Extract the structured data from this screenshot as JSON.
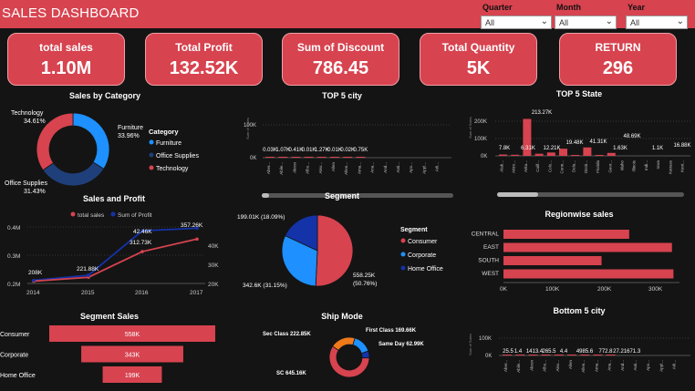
{
  "header": {
    "title": "SALES DASHBOARD"
  },
  "filters": [
    {
      "label": "Quarter",
      "value": "All"
    },
    {
      "label": "Month",
      "value": "All"
    },
    {
      "label": "Year",
      "value": "All"
    }
  ],
  "kpis": [
    {
      "label": "total sales",
      "value": "1.10M"
    },
    {
      "label": "Total Profit",
      "value": "132.52K"
    },
    {
      "label": "Sum of Discount",
      "value": "786.45"
    },
    {
      "label": "Total Quantity",
      "value": "5K"
    },
    {
      "label": "RETURN",
      "value": "296"
    }
  ],
  "colors": {
    "accent": "#d7434f",
    "blue": "#1e90ff",
    "navy": "#1f3f7a",
    "dark_blue": "#1433a8",
    "orange": "#f07a1a",
    "bg": "#141414"
  },
  "charts": {
    "category": {
      "title": "Sales by Category",
      "legend_title": "Category",
      "labels": [
        {
          "name": "Technology",
          "pct": "34.61%"
        },
        {
          "name": "Furniture",
          "pct": "33.96%"
        },
        {
          "name": "Office Supplies",
          "pct": "31.43%"
        }
      ],
      "legend": [
        "Furniture",
        "Office Supplies",
        "Technology"
      ]
    },
    "top5city": {
      "title": "TOP 5 city",
      "ytick": [
        "100K",
        "0K"
      ],
      "axis_label": "Sum of Sales",
      "labels": [
        "0.03K",
        "1.07K",
        "0.41K",
        "0.01K",
        "1.27K",
        "0.01K",
        "0.02K",
        "0.75K"
      ],
      "cities": [
        "Aber...",
        "Abile...",
        "Akron",
        "Albu...",
        "Alex...",
        "Allen",
        "Allen...",
        "Ama...",
        "Ana...",
        "And...",
        "Anti...",
        "Apo...",
        "Appl...",
        "Arli..."
      ]
    },
    "top5state": {
      "title": "TOP 5 State",
      "ytick": [
        "200K",
        "100K",
        "0K"
      ],
      "axis_label": "Sum of Sales",
      "labels": [
        "7.8K",
        "6.31K",
        "213.27K",
        "12.21K",
        "19.48K",
        "41.31K",
        "1.63K",
        "48.69K",
        "1.1K",
        "16.88K"
      ],
      "states": [
        "Alab...",
        "Arizo...",
        "Arka...",
        "Calif...",
        "Colo...",
        "Conn...",
        "Dela...",
        "Distri...",
        "Florida",
        "Geor...",
        "Idaho",
        "Illinois",
        "Indi...",
        "Iowa",
        "Kansas",
        "Kent..."
      ]
    },
    "sales_profit": {
      "title": "Sales and Profit",
      "legend": [
        "total sales",
        "Sum of Profit"
      ],
      "y_left": [
        "0.4M",
        "0.3M",
        "0.2M"
      ],
      "y_right": [
        "40K",
        "30K",
        "20K"
      ],
      "x": [
        "2014",
        "2015",
        "2016",
        "2017"
      ],
      "point_labels": [
        "208K",
        "221.88K",
        "312.73K",
        "42.46K",
        "357.26K"
      ]
    },
    "segment": {
      "title": "Segment",
      "legend_title": "Segment",
      "legend": [
        "Consumer",
        "Corporate",
        "Home Office"
      ],
      "labels": [
        "199.01K (18.09%)",
        "342.6K (31.15%)",
        "558.25K",
        "(50.76%)"
      ]
    },
    "region": {
      "title": "Regionwise sales",
      "regions": [
        "CENTRAL",
        "EAST",
        "SOUTH",
        "WEST"
      ],
      "x": [
        "0K",
        "100K",
        "200K",
        "300K"
      ]
    },
    "segment_sales": {
      "title": "Segment Sales",
      "rows": [
        {
          "name": "Consumer",
          "value": "558K"
        },
        {
          "name": "Corporate",
          "value": "343K"
        },
        {
          "name": "Home Office",
          "value": "199K"
        }
      ]
    },
    "ship": {
      "title": "Ship Mode",
      "labels": [
        "Sec Class 222.85K",
        "First Class 169.66K",
        "Same Day 62.99K",
        "SC 645.16K"
      ]
    },
    "bottom5city": {
      "title": "Bottom 5 city",
      "ytick": [
        "100K",
        "0K"
      ],
      "axis_label": "Sum of Sales",
      "labels": [
        "25.5",
        "1.4",
        "1413.4",
        "265.5",
        "4.4",
        "4985.6",
        "772.8",
        "27.2",
        "1671.3"
      ],
      "cities": [
        "Aber...",
        "Abile...",
        "Akron",
        "Albu...",
        "Alex...",
        "Allen",
        "Allen...",
        "Ama...",
        "Ana...",
        "And...",
        "Anti...",
        "Apo...",
        "Appl...",
        "Arli..."
      ]
    }
  },
  "chart_data": [
    {
      "type": "pie",
      "title": "Sales by Category",
      "categories": [
        "Technology",
        "Furniture",
        "Office Supplies"
      ],
      "values": [
        34.61,
        33.96,
        31.43
      ]
    },
    {
      "type": "bar",
      "title": "TOP 5 city",
      "values": [
        0.03,
        1.07,
        0.41,
        0.01,
        1.27,
        0.01,
        0.02,
        0.75
      ],
      "ylim": [
        0,
        100
      ]
    },
    {
      "type": "bar",
      "title": "TOP 5 State",
      "values": [
        7.8,
        6.31,
        213.27,
        12.21,
        19.48,
        41.31,
        1.63,
        48.69,
        1.1,
        16.88
      ],
      "ylim": [
        0,
        250
      ]
    },
    {
      "type": "line",
      "title": "Sales and Profit",
      "x": [
        "2014",
        "2015",
        "2016",
        "2017"
      ],
      "series": [
        {
          "name": "total sales",
          "values": [
            208,
            221.88,
            312.73,
            357.26
          ]
        },
        {
          "name": "Sum of Profit",
          "values": [
            212,
            232,
            405,
            415
          ]
        }
      ]
    },
    {
      "type": "pie",
      "title": "Segment",
      "categories": [
        "Consumer",
        "Corporate",
        "Home Office"
      ],
      "values": [
        558.25,
        342.6,
        199.01
      ]
    },
    {
      "type": "bar",
      "title": "Regionwise sales",
      "categories": [
        "CENTRAL",
        "EAST",
        "SOUTH",
        "WEST"
      ],
      "values": [
        250,
        335,
        195,
        338
      ],
      "xlim": [
        0,
        350
      ]
    },
    {
      "type": "bar",
      "title": "Segment Sales",
      "categories": [
        "Consumer",
        "Corporate",
        "Home Office"
      ],
      "values": [
        558,
        343,
        199
      ]
    },
    {
      "type": "pie",
      "title": "Ship Mode",
      "categories": [
        "Sec Class",
        "First Class",
        "Same Day",
        "SC"
      ],
      "values": [
        222.85,
        169.66,
        62.99,
        645.16
      ]
    },
    {
      "type": "bar",
      "title": "Bottom 5 city",
      "values": [
        25.5,
        1.4,
        1413.4,
        265.5,
        4.4,
        4985.6,
        772.8,
        27.2,
        1671.3
      ],
      "ylim": [
        0,
        100000
      ]
    }
  ]
}
